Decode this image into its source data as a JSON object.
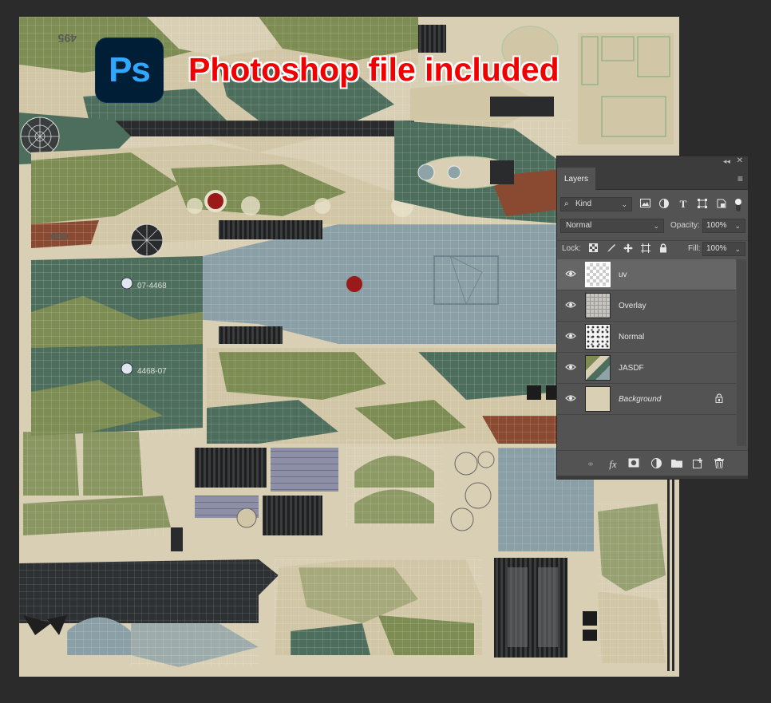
{
  "badge": {
    "logo_text": "Ps",
    "headline": "Photoshop file included"
  },
  "texture_labels": {
    "serial_top": "495",
    "serial_left": "480",
    "tail_code_1": "07-4468",
    "tail_code_2": "4468-07"
  },
  "layers_panel": {
    "tab_label": "Layers",
    "filter_label": "Kind",
    "blend_mode": "Normal",
    "opacity_label": "Opacity:",
    "opacity_value": "100%",
    "lock_label": "Lock:",
    "fill_label": "Fill:",
    "fill_value": "100%",
    "layers": [
      {
        "name": "uv",
        "visible": true,
        "selected": true,
        "locked": false,
        "italic": false
      },
      {
        "name": "Overlay",
        "visible": true,
        "selected": false,
        "locked": false,
        "italic": false
      },
      {
        "name": "Normal",
        "visible": true,
        "selected": false,
        "locked": false,
        "italic": false
      },
      {
        "name": "JASDF",
        "visible": true,
        "selected": false,
        "locked": false,
        "italic": false
      },
      {
        "name": "Background",
        "visible": true,
        "selected": false,
        "locked": true,
        "italic": true
      }
    ],
    "filter_icons": [
      "image-filter-icon",
      "adjustment-filter-icon",
      "type-filter-icon",
      "shape-filter-icon",
      "smart-object-filter-icon"
    ],
    "footer_icons": [
      "link-layers-icon",
      "fx-icon",
      "add-mask-icon",
      "adjustment-layer-icon",
      "new-group-icon",
      "new-layer-icon",
      "delete-layer-icon"
    ]
  },
  "colors": {
    "workspace": "#2b2b2b",
    "panel": "#535353",
    "tan": "#d8cfb5",
    "olive": "#7c8c52",
    "teal_green": "#4e6e5d",
    "pale_blue": "#8ea3a8",
    "brown": "#8a4a32",
    "roundel": "#9a1a1a",
    "headline": "#f00000",
    "ps_blue": "#31a8ff",
    "ps_bg": "#001e36"
  }
}
